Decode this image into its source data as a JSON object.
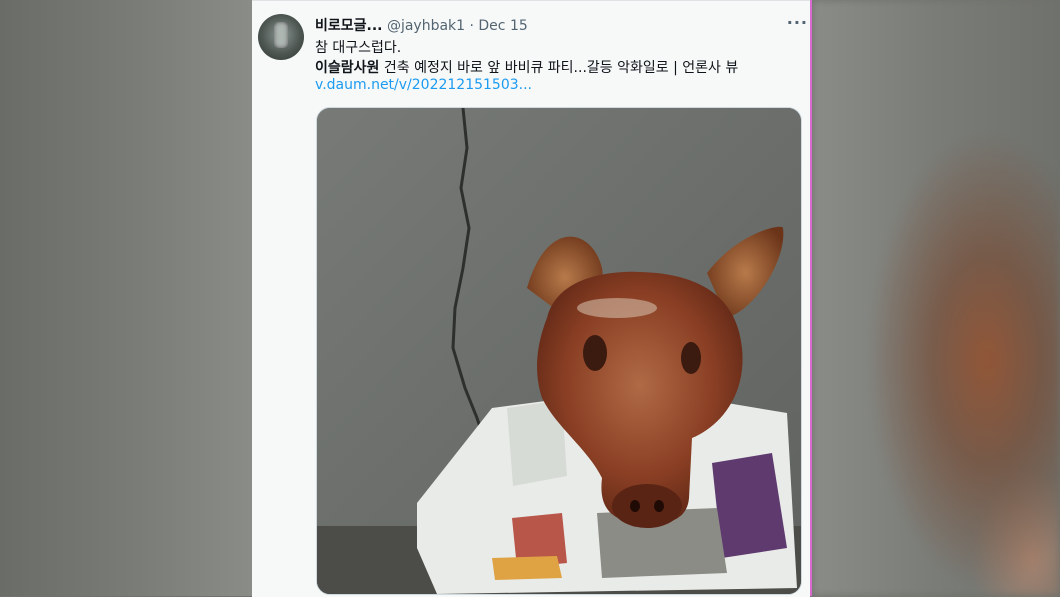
{
  "tweet": {
    "display_name": "비로모글...",
    "handle": "@jayhbak1",
    "separator": "·",
    "date": "Dec 15",
    "more_label": "···",
    "text_line1": "참 대구스럽다.",
    "article_bold": "이슬람사원",
    "article_rest": " 건축 예정지 바로 앞 바비큐 파티...갈등 악화일로 | 언론사 뷰",
    "link_text": "v.daum.net/v/202212151503...",
    "media_icon": "roasted-pig-head-photo"
  },
  "colors": {
    "card_bg": "#f7f9f9",
    "text": "#0f1419",
    "muted": "#536471",
    "link": "#1d9bf0",
    "page_bg": "#6f716c"
  }
}
